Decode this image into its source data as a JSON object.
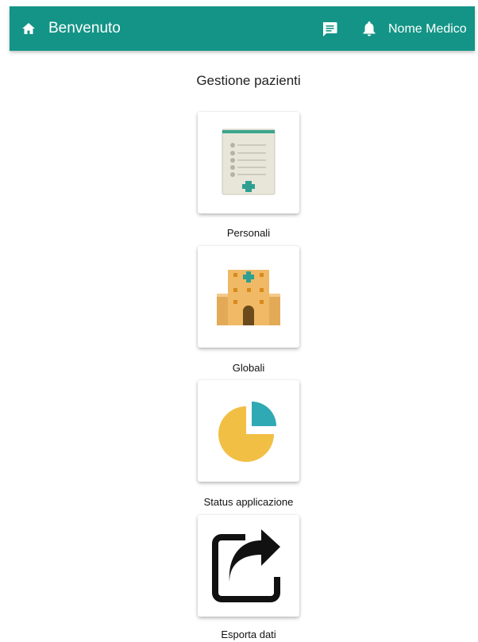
{
  "topbar": {
    "title": "Benvenuto",
    "user_name": "Nome Medico",
    "background_color": "#139486",
    "icons": {
      "home": "home-icon",
      "chat": "chat-icon",
      "notifications": "bell-icon"
    }
  },
  "main": {
    "section_title": "Gestione pazienti",
    "tiles": [
      {
        "label": "Personali",
        "icon": "patient-record-icon"
      },
      {
        "label": "Globali",
        "icon": "hospital-icon"
      },
      {
        "label": "Status applicazione",
        "icon": "pie-chart-icon"
      },
      {
        "label": "Esporta dati",
        "icon": "share-export-icon"
      }
    ]
  }
}
